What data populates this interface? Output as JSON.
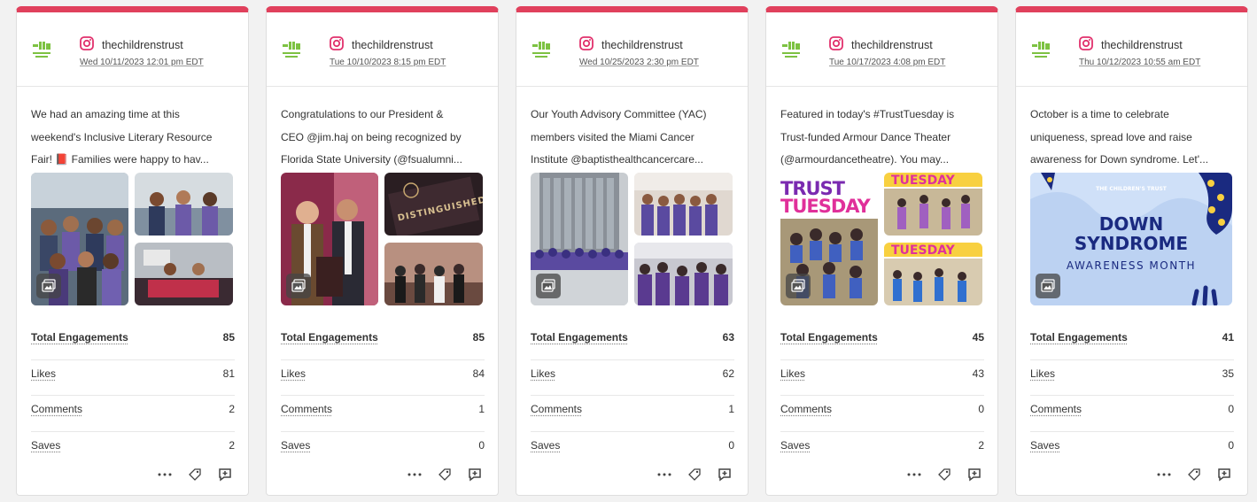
{
  "cards": [
    {
      "handle": "thechildrenstrust",
      "date": "Wed 10/11/2023 12:01 pm EDT",
      "caption": [
        "We had an amazing time at this",
        "weekend's Inclusive Literary Resource",
        "Fair! 📕 Families were happy to hav..."
      ],
      "metrics": [
        {
          "label": "Total Engagements",
          "value": "85"
        },
        {
          "label": "Likes",
          "value": "81"
        },
        {
          "label": "Comments",
          "value": "2"
        },
        {
          "label": "Saves",
          "value": "2"
        }
      ]
    },
    {
      "handle": "thechildrenstrust",
      "date": "Tue 10/10/2023 8:15 pm EDT",
      "caption": [
        "Congratulations to our President &",
        "CEO @jim.haj on being recognized by",
        "Florida State University (@fsualumni..."
      ],
      "metrics": [
        {
          "label": "Total Engagements",
          "value": "85"
        },
        {
          "label": "Likes",
          "value": "84"
        },
        {
          "label": "Comments",
          "value": "1"
        },
        {
          "label": "Saves",
          "value": "0"
        }
      ]
    },
    {
      "handle": "thechildrenstrust",
      "date": "Wed 10/25/2023 2:30 pm EDT",
      "caption": [
        "Our Youth Advisory Committee (YAC)",
        "members visited the Miami Cancer",
        "Institute @baptisthealthcancercare..."
      ],
      "metrics": [
        {
          "label": "Total Engagements",
          "value": "63"
        },
        {
          "label": "Likes",
          "value": "62"
        },
        {
          "label": "Comments",
          "value": "1"
        },
        {
          "label": "Saves",
          "value": "0"
        }
      ]
    },
    {
      "handle": "thechildrenstrust",
      "date": "Tue 10/17/2023 4:08 pm EDT",
      "caption": [
        "Featured in today's #TrustTuesday is",
        "Trust-funded Armour Dance Theater",
        "(@armourdancetheatre). You may..."
      ],
      "metrics": [
        {
          "label": "Total Engagements",
          "value": "45"
        },
        {
          "label": "Likes",
          "value": "43"
        },
        {
          "label": "Comments",
          "value": "0"
        },
        {
          "label": "Saves",
          "value": "2"
        }
      ]
    },
    {
      "handle": "thechildrenstrust",
      "date": "Thu 10/12/2023 10:55 am EDT",
      "caption": [
        "October is a time to celebrate",
        "uniqueness, spread love and raise",
        "awareness for Down syndrome. Let'..."
      ],
      "metrics": [
        {
          "label": "Total Engagements",
          "value": "41"
        },
        {
          "label": "Likes",
          "value": "35"
        },
        {
          "label": "Comments",
          "value": "0"
        },
        {
          "label": "Saves",
          "value": "0"
        }
      ]
    }
  ],
  "photo_text": {
    "distinguished": "DISTINGUISHED",
    "trust": "TRUST",
    "tuesday": "TUESDAY",
    "down": "DOWN",
    "syndrome": "SYNDROME",
    "awareness": "AWARENESS MONTH"
  },
  "icons": {
    "platform": "instagram-icon",
    "gallery": "gallery-icon",
    "more": "more-icon",
    "tag": "tag-icon",
    "comment": "comment-icon"
  },
  "colors": {
    "accent": "#e0405c",
    "brand_green": "#7dc242",
    "instagram": "#e1306c"
  }
}
